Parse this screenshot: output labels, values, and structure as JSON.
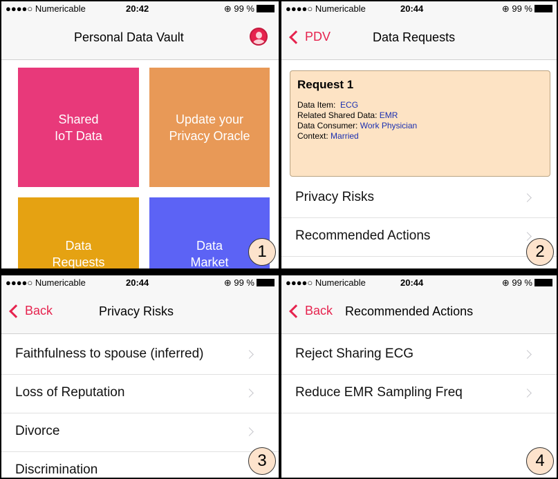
{
  "status": {
    "carrier": "●●●●○ Numericable",
    "battery": "99 %"
  },
  "screen1": {
    "time": "20:42",
    "title": "Personal Data Vault",
    "tiles": [
      {
        "label": "Shared\nIoT Data",
        "color": "#e8397a"
      },
      {
        "label": "Update your\nPrivacy Oracle",
        "color": "#e89957"
      },
      {
        "label": "Data\nRequests",
        "color": "#e5a212"
      },
      {
        "label": "Data\nMarket",
        "color": "#5c63f5"
      }
    ],
    "badge": "1"
  },
  "screen2": {
    "time": "20:44",
    "back": "PDV",
    "title": "Data Requests",
    "request": {
      "title": "Request 1",
      "data_item_label": "Data Item:",
      "data_item": "ECG",
      "related_label": "Related Shared Data:",
      "related": "EMR",
      "consumer_label": "Data Consumer:",
      "consumer": "Work Physician",
      "context_label": "Context:",
      "context": "Married"
    },
    "rows": [
      "Privacy Risks",
      "Recommended Actions"
    ],
    "badge": "2"
  },
  "screen3": {
    "time": "20:44",
    "back": "Back",
    "title": "Privacy Risks",
    "rows": [
      "Faithfulness to spouse (inferred)",
      "Loss of Reputation",
      "Divorce",
      "Discrimination"
    ],
    "badge": "3"
  },
  "screen4": {
    "time": "20:44",
    "back": "Back",
    "title": "Recommended Actions",
    "rows": [
      "Reject Sharing ECG",
      "Reduce EMR Sampling Freq"
    ],
    "badge": "4"
  },
  "colors": {
    "accent": "#e6234e",
    "value_text": "#1a2fb0",
    "card_bg": "#fde3c4"
  }
}
